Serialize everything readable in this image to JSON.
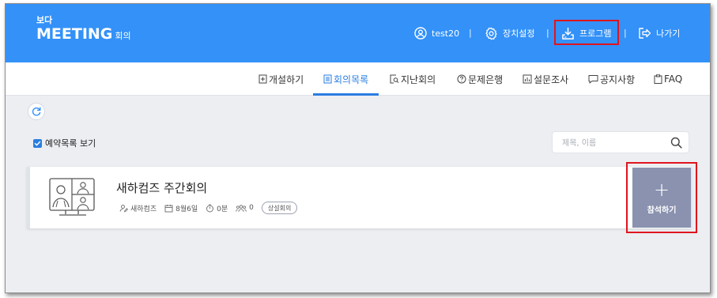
{
  "header": {
    "logo_sub": "보다",
    "logo_main": "MEETING",
    "logo_suffix": "회의",
    "user": "test20",
    "device_settings": "장치설정",
    "program": "프로그램",
    "exit": "나가기",
    "separator": "|"
  },
  "nav": {
    "tabs": [
      {
        "label": "개설하기",
        "icon": "create-icon"
      },
      {
        "label": "회의목록",
        "icon": "list-icon",
        "active": true
      },
      {
        "label": "지난회의",
        "icon": "search-doc-icon"
      },
      {
        "label": "문제은행",
        "icon": "question-icon"
      },
      {
        "label": "설문조사",
        "icon": "chart-icon"
      },
      {
        "label": "공지사항",
        "icon": "chat-icon"
      },
      {
        "label": "FAQ",
        "icon": "clipboard-icon"
      }
    ]
  },
  "content": {
    "show_reservations": "예약목록 보기",
    "search_placeholder": "제목, 이름"
  },
  "meeting": {
    "title": "새하컴즈 주간회의",
    "host": "새하컴즈",
    "date": "8월6일",
    "duration": "0분",
    "participants": "0",
    "status": "상설회의",
    "join_plus": "+",
    "join_label": "참석하기"
  },
  "colors": {
    "header_bg": "#3391f8",
    "accent": "#2a7de1",
    "join_button": "#8a92b0",
    "highlight_box": "#e0141e"
  }
}
